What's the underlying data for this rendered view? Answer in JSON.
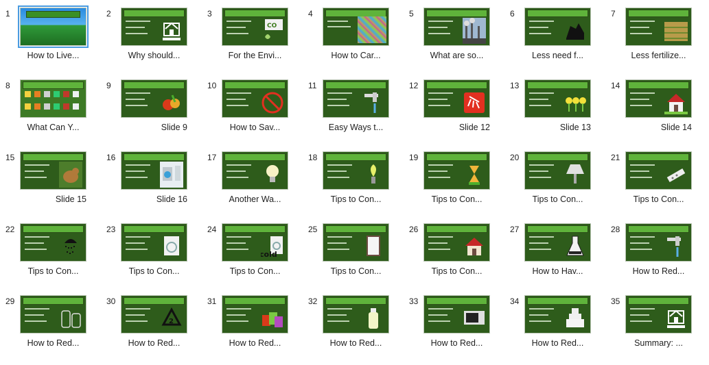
{
  "slides": [
    {
      "number": "1",
      "caption": "How to Live...",
      "style": "forest",
      "selected": true
    },
    {
      "number": "2",
      "caption": "Why should...",
      "style": "logo"
    },
    {
      "number": "3",
      "caption": "For the Envi...",
      "style": "co2"
    },
    {
      "number": "4",
      "caption": "How to Car...",
      "style": "colorful"
    },
    {
      "number": "5",
      "caption": "What are so...",
      "style": "factory"
    },
    {
      "number": "6",
      "caption": "Less need f...",
      "style": "dark"
    },
    {
      "number": "7",
      "caption": "Less fertilize...",
      "style": "field"
    },
    {
      "number": "8",
      "caption": "What Can Y...",
      "style": "icons"
    },
    {
      "number": "9",
      "caption": "Slide 9",
      "style": "veg"
    },
    {
      "number": "10",
      "caption": "How to Sav...",
      "style": "noentry"
    },
    {
      "number": "11",
      "caption": "Easy Ways t...",
      "style": "tap"
    },
    {
      "number": "12",
      "caption": "Slide 12",
      "style": "redshower"
    },
    {
      "number": "13",
      "caption": "Slide 13",
      "style": "flowers"
    },
    {
      "number": "14",
      "caption": "Slide 14",
      "style": "house"
    },
    {
      "number": "15",
      "caption": "Slide 15",
      "style": "dog"
    },
    {
      "number": "16",
      "caption": "Slide 16",
      "style": "laundry"
    },
    {
      "number": "17",
      "caption": "Another Wa...",
      "style": "bulb"
    },
    {
      "number": "18",
      "caption": "Tips to Con...",
      "style": "bulb2"
    },
    {
      "number": "19",
      "caption": "Tips to Con...",
      "style": "timer"
    },
    {
      "number": "20",
      "caption": "Tips to Con...",
      "style": "lamp"
    },
    {
      "number": "21",
      "caption": "Tips to Con...",
      "style": "strip"
    },
    {
      "number": "22",
      "caption": "Tips to Con...",
      "style": "shower"
    },
    {
      "number": "23",
      "caption": "Tips to Con...",
      "style": "washer"
    },
    {
      "number": "24",
      "caption": "Tips to Con...",
      "style": "cold"
    },
    {
      "number": "25",
      "caption": "Tips to Con...",
      "style": "window"
    },
    {
      "number": "26",
      "caption": "Tips to Con...",
      "style": "redhouse"
    },
    {
      "number": "27",
      "caption": "How to Hav...",
      "style": "flask"
    },
    {
      "number": "28",
      "caption": "How to Red...",
      "style": "tap2"
    },
    {
      "number": "29",
      "caption": "How to Red...",
      "style": "jars"
    },
    {
      "number": "30",
      "caption": "How to Red...",
      "style": "recycle"
    },
    {
      "number": "31",
      "caption": "How to Red...",
      "style": "cans"
    },
    {
      "number": "32",
      "caption": "How to Red...",
      "style": "bottle"
    },
    {
      "number": "33",
      "caption": "How to Red...",
      "style": "microwave"
    },
    {
      "number": "34",
      "caption": "How to Red...",
      "style": "cake"
    },
    {
      "number": "35",
      "caption": "Summary: ...",
      "style": "logo"
    }
  ],
  "colors": {
    "slide_bg": "#2e5c1b",
    "title_bar": "#5fb33b",
    "selection": "#4a9be0"
  }
}
